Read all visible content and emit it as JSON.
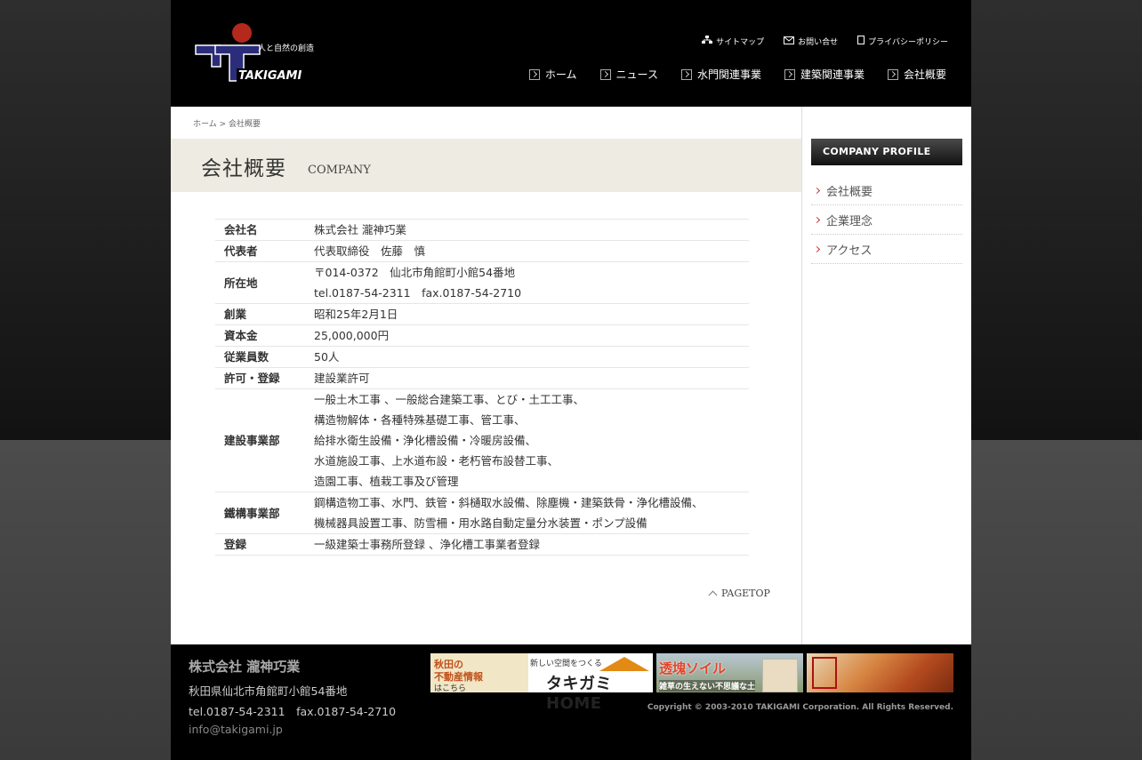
{
  "header": {
    "logo_tagline": "人と自然の創造",
    "logo_name": "TAKIGAMI",
    "util_nav": [
      {
        "label": "サイトマップ",
        "icon": "sitemap-icon"
      },
      {
        "label": "お問い合せ",
        "icon": "mail-icon"
      },
      {
        "label": "プライバシーポリシー",
        "icon": "document-icon"
      }
    ],
    "main_nav": [
      "ホーム",
      "ニュース",
      "水門関連事業",
      "建築関連事業",
      "会社概要"
    ]
  },
  "breadcrumb": {
    "home": "ホーム",
    "sep": ">",
    "current": "会社概要"
  },
  "page": {
    "title": "会社概要",
    "subtitle": "COMPANY"
  },
  "company_table": [
    {
      "key": "会社名",
      "lines": [
        "株式会社 瀧神巧業"
      ]
    },
    {
      "key": "代表者",
      "lines": [
        "代表取締役　佐藤　慎"
      ]
    },
    {
      "key": "所在地",
      "lines": [
        "〒014-0372　仙北市角館町小館54番地",
        "tel.0187-54-2311　fax.0187-54-2710"
      ]
    },
    {
      "key": "創業",
      "lines": [
        "昭和25年2月1日"
      ]
    },
    {
      "key": "資本金",
      "lines": [
        "25,000,000円"
      ]
    },
    {
      "key": "従業員数",
      "lines": [
        "50人"
      ]
    },
    {
      "key": "許可・登録",
      "lines": [
        "建設業許可"
      ]
    },
    {
      "key": "建設事業部",
      "lines": [
        "一般土木工事 、一般総合建築工事、とび・土工工事、",
        "構造物解体・各種特殊基礎工事、管工事、",
        "給排水衛生設備・浄化槽設備・冷暖房設備、",
        "水道施設工事、上水道布設・老朽管布設替工事、",
        "造園工事、植栽工事及び管理"
      ]
    },
    {
      "key": "鐵構事業部",
      "lines": [
        "鋼構造物工事、水門、鉄管・斜樋取水設備、除塵機・建築鉄骨・浄化槽設備、",
        "機械器具設置工事、防雪柵・用水路自動定量分水装置・ポンプ設備"
      ]
    },
    {
      "key": "登録",
      "lines": [
        "一級建築士事務所登録 、浄化槽工事業者登録"
      ]
    }
  ],
  "pagetop": "PAGETOP",
  "sidebar": {
    "heading": "COMPANY PROFILE",
    "items": [
      "会社概要",
      "企業理念",
      "アクセス"
    ]
  },
  "footer": {
    "company": "株式会社 瀧神巧業",
    "address": "秋田県仙北市角館町小館54番地",
    "tel": "tel.0187-54-2311　fax.0187-54-2710",
    "email": "info@takigami.jp",
    "copyright": "Copyright © 2003-2010 TAKIGAMI Corporation. All Rights Reserved.",
    "banner1": {
      "line1": "秋田の",
      "line2": "不動産情報",
      "line3": "はこちら",
      "tag": "新しい空間をつくる",
      "name": "タキガミHOME"
    },
    "banner2": {
      "title": "透塊ソイル",
      "sub": "雑草の生えない不思議な土"
    }
  },
  "colors": {
    "accent_red": "#c33333",
    "title_band": "#eeece2",
    "header_bg": "#000000"
  }
}
